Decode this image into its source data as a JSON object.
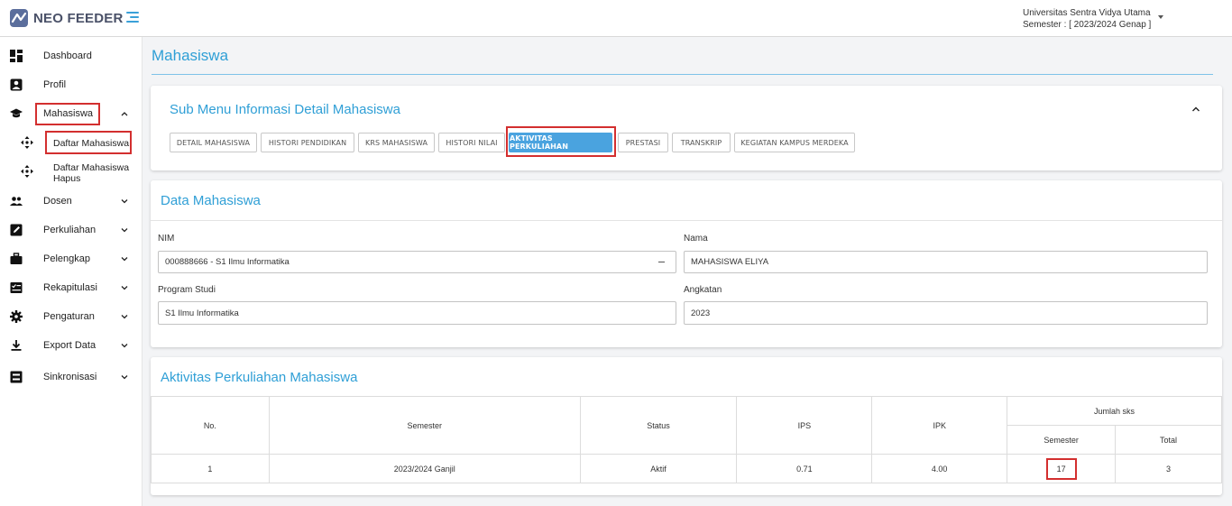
{
  "app": {
    "name": "NEO FEEDER"
  },
  "header": {
    "university": "Universitas Sentra Vidya Utama",
    "semester": "Semester : [ 2023/2024 Genap ]"
  },
  "sidebar": {
    "items": [
      {
        "label": "Dashboard",
        "icon": "dashboard-icon"
      },
      {
        "label": "Profil",
        "icon": "profile-icon"
      },
      {
        "label": "Mahasiswa",
        "icon": "graduation-cap-icon"
      },
      {
        "label": "Dosen",
        "icon": "people-icon"
      },
      {
        "label": "Perkuliahan",
        "icon": "edit-square-icon"
      },
      {
        "label": "Pelengkap",
        "icon": "briefcase-icon"
      },
      {
        "label": "Rekapitulasi",
        "icon": "report-icon"
      },
      {
        "label": "Pengaturan",
        "icon": "gear-icon"
      },
      {
        "label": "Export Data",
        "icon": "download-icon"
      },
      {
        "label": "Sinkronisasi",
        "icon": "sync-icon"
      }
    ],
    "submenu": [
      {
        "label": "Daftar Mahasiswa"
      },
      {
        "label": "Daftar Mahasiswa Hapus"
      }
    ]
  },
  "page": {
    "title": "Mahasiswa"
  },
  "submenu_card": {
    "title": "Sub Menu Informasi Detail Mahasiswa",
    "tabs": [
      "DETAIL MAHASISWA",
      "HISTORI PENDIDIKAN",
      "KRS MAHASISWA",
      "HISTORI NILAI",
      "AKTIVITAS PERKULIAHAN",
      "PRESTASI",
      "TRANSKRIP",
      "KEGIATAN KAMPUS MERDEKA"
    ],
    "active_tab": "AKTIVITAS PERKULIAHAN"
  },
  "data_mahasiswa": {
    "title": "Data Mahasiswa",
    "nim_label": "NIM",
    "nim_value": "000888666 - S1 Ilmu Informatika",
    "nama_label": "Nama",
    "nama_value": "MAHASISWA ELIYA",
    "prodi_label": "Program Studi",
    "prodi_value": "S1 Ilmu Informatika",
    "angkatan_label": "Angkatan",
    "angkatan_value": "2023"
  },
  "aktivitas": {
    "title": "Aktivitas Perkuliahan Mahasiswa",
    "headers": {
      "no": "No.",
      "semester": "Semester",
      "status": "Status",
      "ips": "IPS",
      "ipk": "IPK",
      "jumlah_sks": "Jumlah sks",
      "sks_semester": "Semester",
      "sks_total": "Total"
    },
    "rows": [
      {
        "no": "1",
        "semester": "2023/2024 Ganjil",
        "status": "Aktif",
        "ips": "0.71",
        "ipk": "4.00",
        "sks_semester": "17",
        "sks_total": "3"
      }
    ]
  },
  "colors": {
    "accent": "#2f9fd6",
    "active_tab": "#4aa3df",
    "highlight": "#d32f2f"
  }
}
